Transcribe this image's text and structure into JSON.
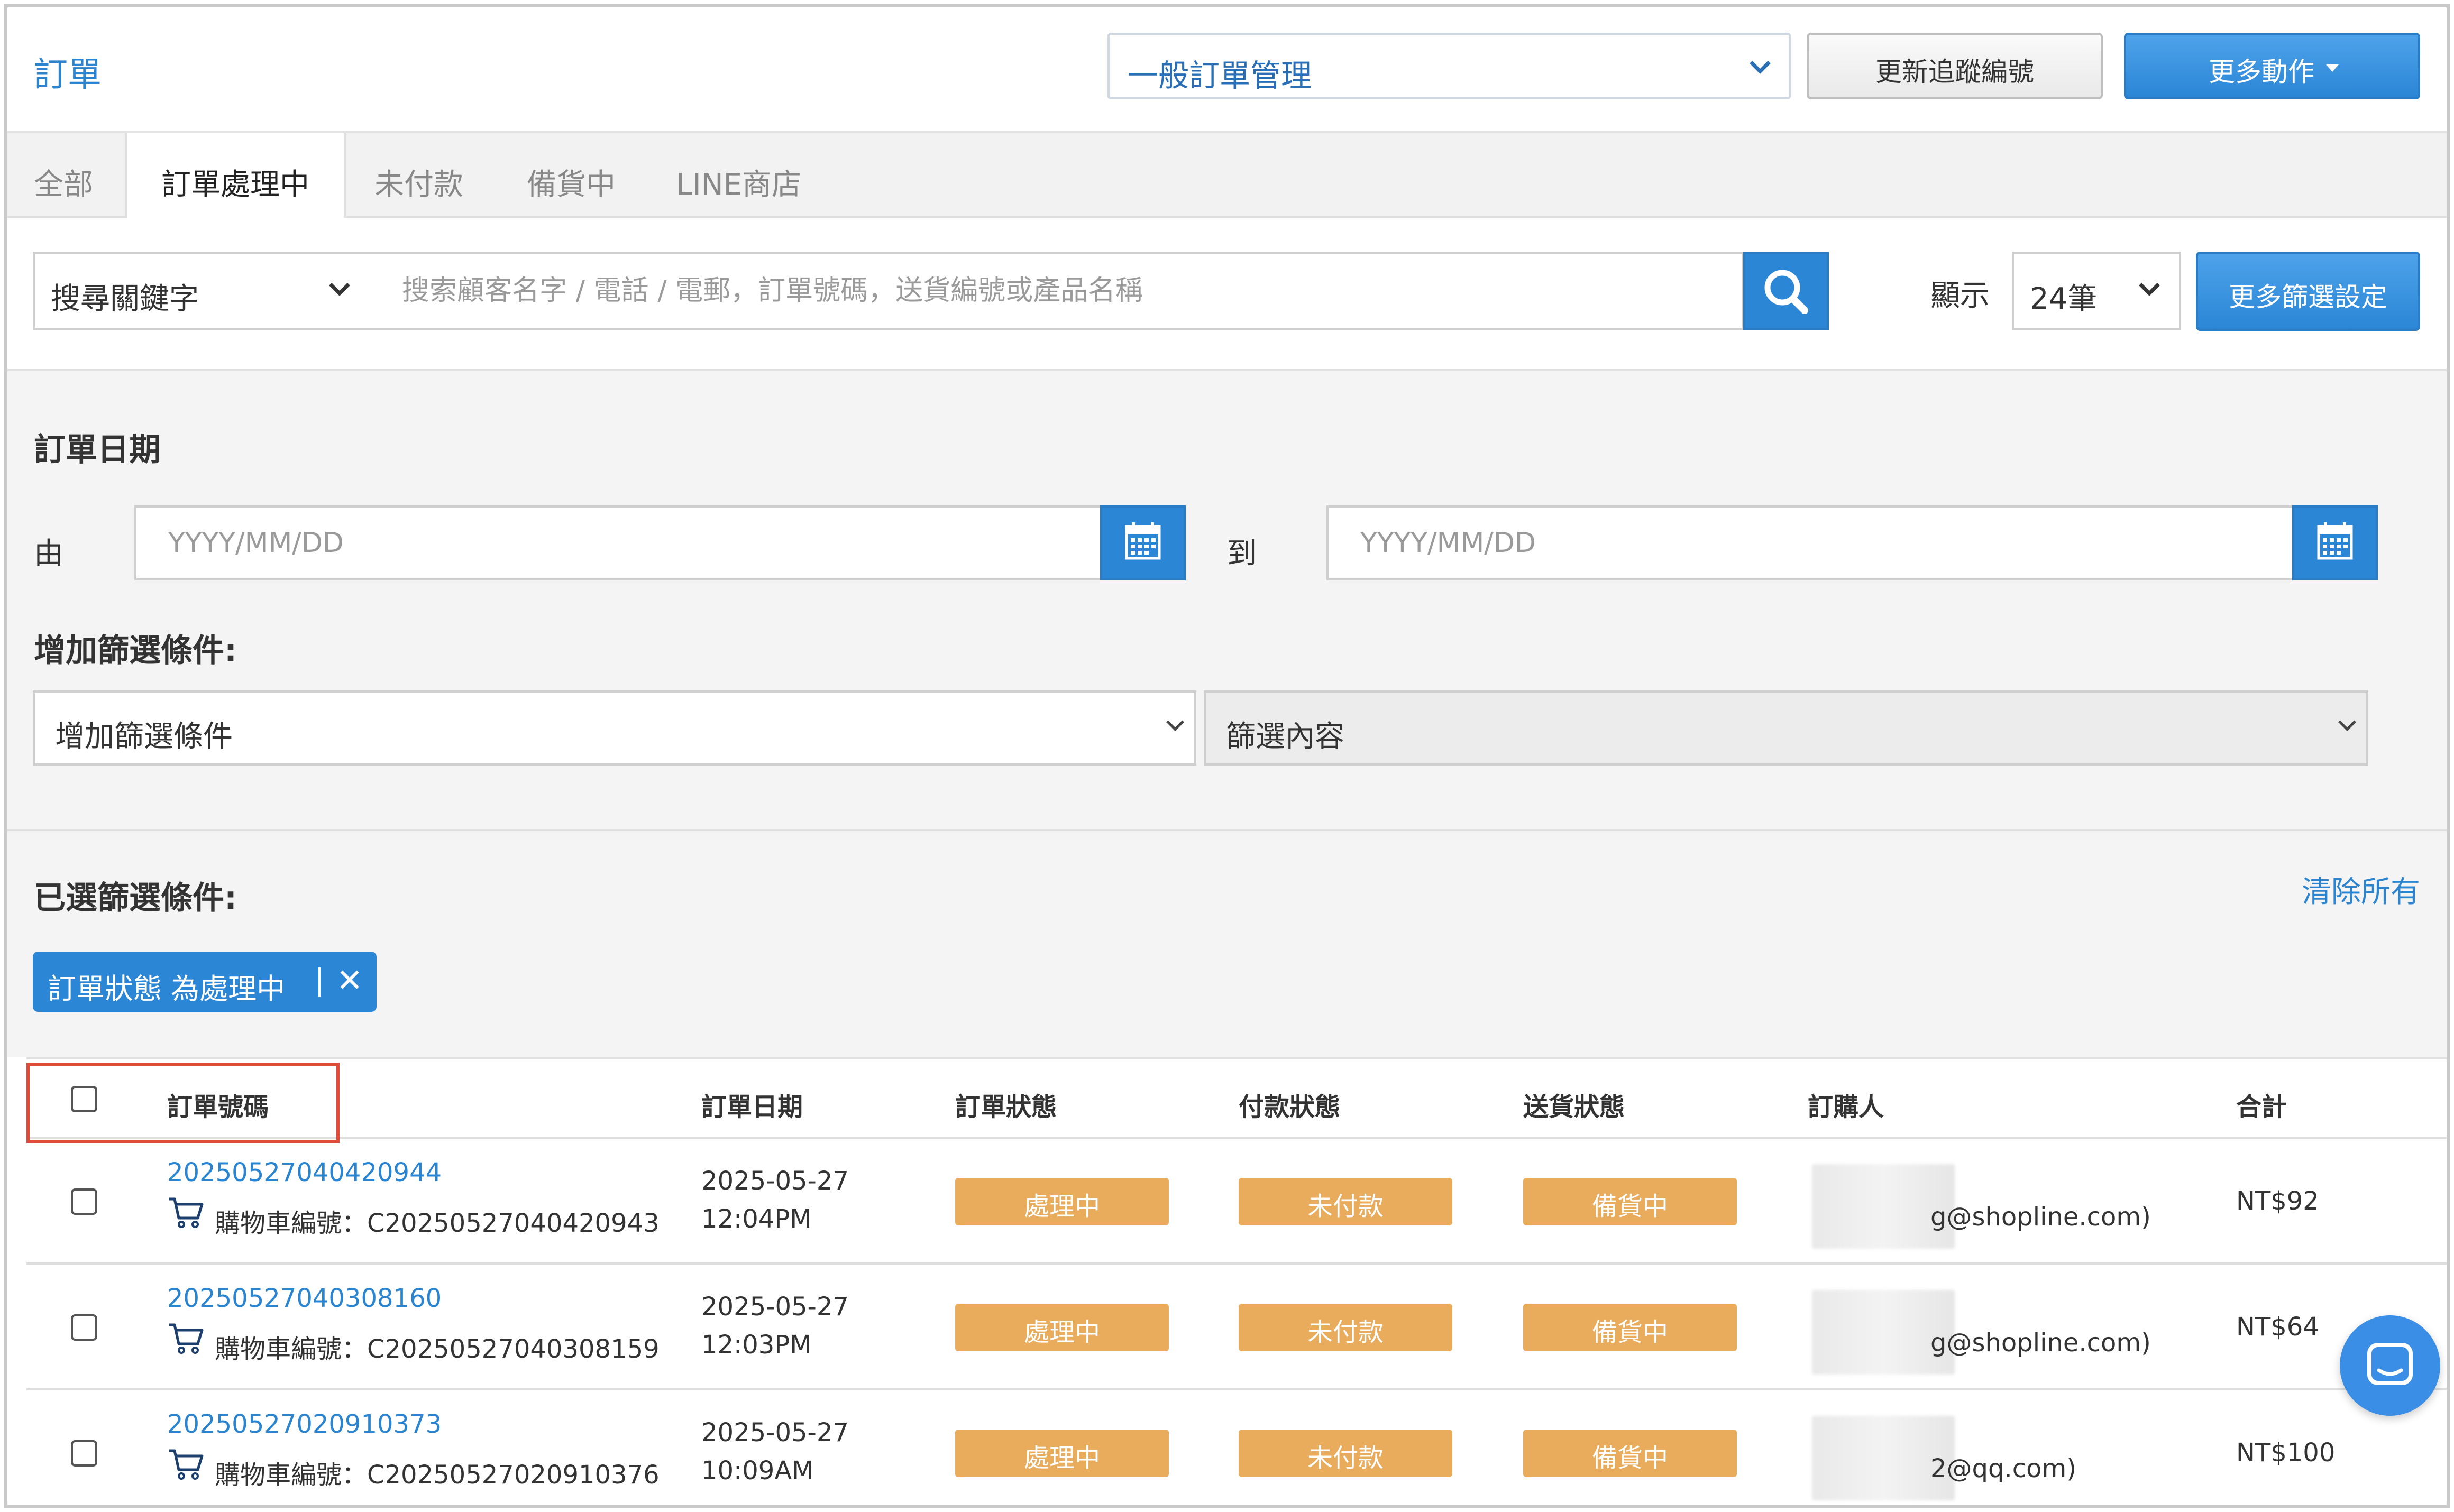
{
  "header": {
    "title": "訂單",
    "management_select": "一般訂單管理",
    "update_tracking_label": "更新追蹤編號",
    "more_actions_label": "更多動作"
  },
  "tabs": [
    {
      "label": "全部"
    },
    {
      "label": "訂單處理中"
    },
    {
      "label": "未付款"
    },
    {
      "label": "備貨中"
    },
    {
      "label": "LINE商店"
    }
  ],
  "search": {
    "keyword_select": "搜尋關鍵字",
    "placeholder": "搜索顧客名字 / 電話 / 電郵，訂單號碼，送貨編號或產品名稱",
    "show_label": "顯示",
    "per_page": "24筆",
    "more_filters_label": "更多篩選設定"
  },
  "filters": {
    "order_date_heading": "訂單日期",
    "from_label": "由",
    "to_label": "到",
    "date_placeholder": "YYYY/MM/DD",
    "add_filter_heading": "增加篩選條件:",
    "add_filter_select": "增加篩選條件",
    "filter_content_select": "篩選內容",
    "selected_heading": "已選篩選條件:",
    "clear_all": "清除所有",
    "chip_label": "訂單狀態 為處理中"
  },
  "table": {
    "headers": {
      "order_no": "訂單號碼",
      "order_date": "訂單日期",
      "order_status": "訂單狀態",
      "payment_status": "付款狀態",
      "delivery_status": "送貨狀態",
      "buyer": "訂購人",
      "total": "合計"
    },
    "rows": [
      {
        "order_no": "20250527040420944",
        "cart": "購物車編號：C20250527040420943",
        "date": "2025-05-27",
        "time": "12:04PM",
        "order_status": "處理中",
        "payment_status": "未付款",
        "delivery_status": "備貨中",
        "buyer_email": "g@shopline.com)",
        "total": "NT$92"
      },
      {
        "order_no": "20250527040308160",
        "cart": "購物車編號：C20250527040308159",
        "date": "2025-05-27",
        "time": "12:03PM",
        "order_status": "處理中",
        "payment_status": "未付款",
        "delivery_status": "備貨中",
        "buyer_email": "g@shopline.com)",
        "total": "NT$64"
      },
      {
        "order_no": "20250527020910373",
        "cart": "購物車編號：C20250527020910376",
        "date": "2025-05-27",
        "time": "10:09AM",
        "order_status": "處理中",
        "payment_status": "未付款",
        "delivery_status": "備貨中",
        "buyer_email": "2@qq.com)",
        "total": "NT$100"
      }
    ]
  },
  "colors": {
    "accent": "#2b86d6",
    "badge": "#e8ac5c",
    "highlight": "#e04b3b"
  }
}
